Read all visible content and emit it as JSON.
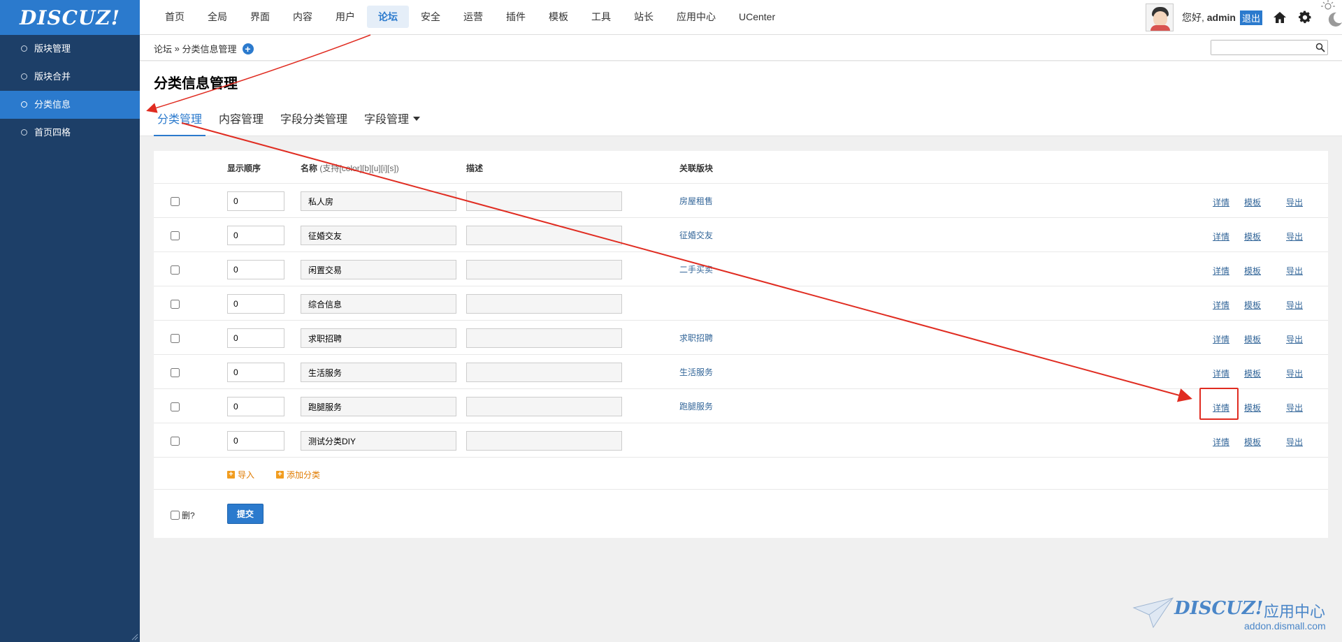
{
  "app": {
    "logo_text": "DISCUZ!",
    "brand_color": "#2b7acd"
  },
  "topnav": [
    {
      "label": "首页",
      "active": false
    },
    {
      "label": "全局",
      "active": false
    },
    {
      "label": "界面",
      "active": false
    },
    {
      "label": "内容",
      "active": false
    },
    {
      "label": "用户",
      "active": false
    },
    {
      "label": "论坛",
      "active": true
    },
    {
      "label": "安全",
      "active": false
    },
    {
      "label": "运营",
      "active": false
    },
    {
      "label": "插件",
      "active": false
    },
    {
      "label": "模板",
      "active": false
    },
    {
      "label": "工具",
      "active": false
    },
    {
      "label": "站长",
      "active": false
    },
    {
      "label": "应用中心",
      "active": false
    },
    {
      "label": "UCenter",
      "active": false
    }
  ],
  "user": {
    "greeting": "您好, ",
    "username": "admin",
    "logout_label": "退出"
  },
  "sidebar": {
    "items": [
      {
        "label": "版块管理",
        "active": false
      },
      {
        "label": "版块合并",
        "active": false
      },
      {
        "label": "分类信息",
        "active": true
      },
      {
        "label": "首页四格",
        "active": false
      }
    ]
  },
  "breadcrumb": {
    "root": "论坛",
    "separator": " » ",
    "current": "分类信息管理"
  },
  "search": {
    "placeholder": "",
    "value": ""
  },
  "page": {
    "title": "分类信息管理"
  },
  "tabs": [
    {
      "label": "分类管理",
      "active": true,
      "dropdown": false
    },
    {
      "label": "内容管理",
      "active": false,
      "dropdown": false
    },
    {
      "label": "字段分类管理",
      "active": false,
      "dropdown": false
    },
    {
      "label": "字段管理",
      "active": false,
      "dropdown": true
    }
  ],
  "table": {
    "headers": {
      "order": "显示顺序",
      "name": "名称",
      "name_hint": "(支持[color][b][u][i][s])",
      "desc": "描述",
      "forum": "关联版块"
    },
    "rows": [
      {
        "order": "0",
        "name": "私人房",
        "desc": "",
        "forum": "房屋租售"
      },
      {
        "order": "0",
        "name": "征婚交友",
        "desc": "",
        "forum": "征婚交友"
      },
      {
        "order": "0",
        "name": "闲置交易",
        "desc": "",
        "forum": "二手买卖"
      },
      {
        "order": "0",
        "name": "综合信息",
        "desc": "",
        "forum": ""
      },
      {
        "order": "0",
        "name": "求职招聘",
        "desc": "",
        "forum": "求职招聘"
      },
      {
        "order": "0",
        "name": "生活服务",
        "desc": "",
        "forum": "生活服务"
      },
      {
        "order": "0",
        "name": "跑腿服务",
        "desc": "",
        "forum": "跑腿服务"
      },
      {
        "order": "0",
        "name": "测试分类DIY",
        "desc": "",
        "forum": ""
      }
    ],
    "row_actions": {
      "detail": "详情",
      "template": "模板",
      "export": "导出"
    },
    "import_label": "导入",
    "add_label": "添加分类",
    "delete_label": "删?",
    "submit_label": "提交"
  },
  "annotation": {
    "color": "#e02c21"
  },
  "watermark": {
    "brand": "DISCUZ!",
    "suffix": "应用中心",
    "url": "addon.dismall.com"
  }
}
